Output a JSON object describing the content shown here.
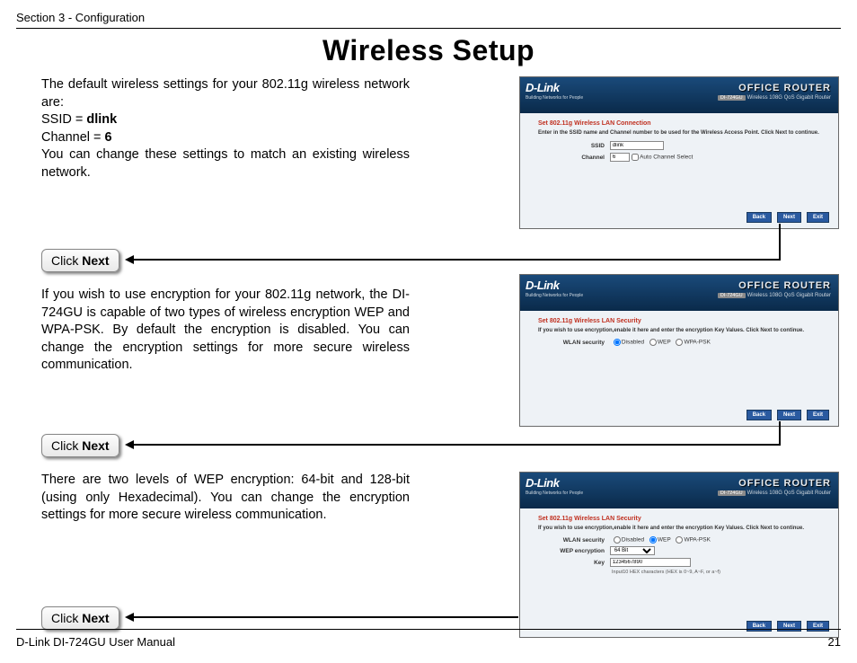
{
  "header": {
    "section": "Section 3 - Configuration"
  },
  "title": "Wireless Setup",
  "left": {
    "p1a": "The default wireless settings for your 802.11g wireless network are:",
    "ssid_label": "SSID = ",
    "ssid_value": "dlink",
    "channel_label": "Channel = ",
    "channel_value": "6",
    "p1b": "You can change these settings to match an existing wireless network.",
    "click1_a": "Click ",
    "click1_b": "Next",
    "p2": "If you wish to use encryption for your 802.11g network, the DI-724GU is capable of two types of wireless encryption WEP and WPA-PSK. By default the encryption is disabled. You can change the encryption settings for more secure wireless communication.",
    "click2_a": "Click ",
    "click2_b": "Next",
    "p3": "There are two levels of WEP encryption: 64-bit and 128-bit (using only Hexadecimal). You can change the encryption settings for more secure wireless communication.",
    "click3_a": "Click ",
    "click3_b": "Next"
  },
  "ss_common": {
    "logo": "D-Link",
    "logo_sub": "Building Networks for People",
    "office": "OFFICE ROUTER",
    "model_badge": "DI-724GU",
    "model": "Wireless 108G QoS Gigabit Router",
    "back": "Back",
    "next": "Next",
    "exit": "Exit"
  },
  "ss1": {
    "step": "Set 802.11g Wireless LAN Connection",
    "instr": "Enter in the SSID name and Channel number to be used for the Wireless Access Point. Click Next to continue.",
    "ssid_label": "SSID",
    "ssid_value": "dlink",
    "channel_label": "Channel",
    "channel_value": "6",
    "auto": "Auto Channel Select"
  },
  "ss2": {
    "step": "Set 802.11g Wireless LAN Security",
    "instr": "If you wish to use encryption,enable it here and enter the encryption Key Values. Click Next to continue.",
    "sec_label": "WLAN security",
    "opt_disabled": "Disabled",
    "opt_wep": "WEP",
    "opt_wpa": "WPA-PSK"
  },
  "ss3": {
    "step": "Set 802.11g Wireless LAN Security",
    "instr": "If you wish to use encryption,enable it here and enter the encryption Key Values. Click Next to continue.",
    "sec_label": "WLAN security",
    "opt_disabled": "Disabled",
    "opt_wep": "WEP",
    "opt_wpa": "WPA-PSK",
    "enc_label": "WEP encryption",
    "enc_value": "64 Bit",
    "key_label": "Key",
    "key_value": "1234567890",
    "hint": "Input10 HEX characters (HEX is 0~9, A~F, or a~f)"
  },
  "footer": {
    "left": "D-Link DI-724GU User Manual",
    "page": "21"
  }
}
